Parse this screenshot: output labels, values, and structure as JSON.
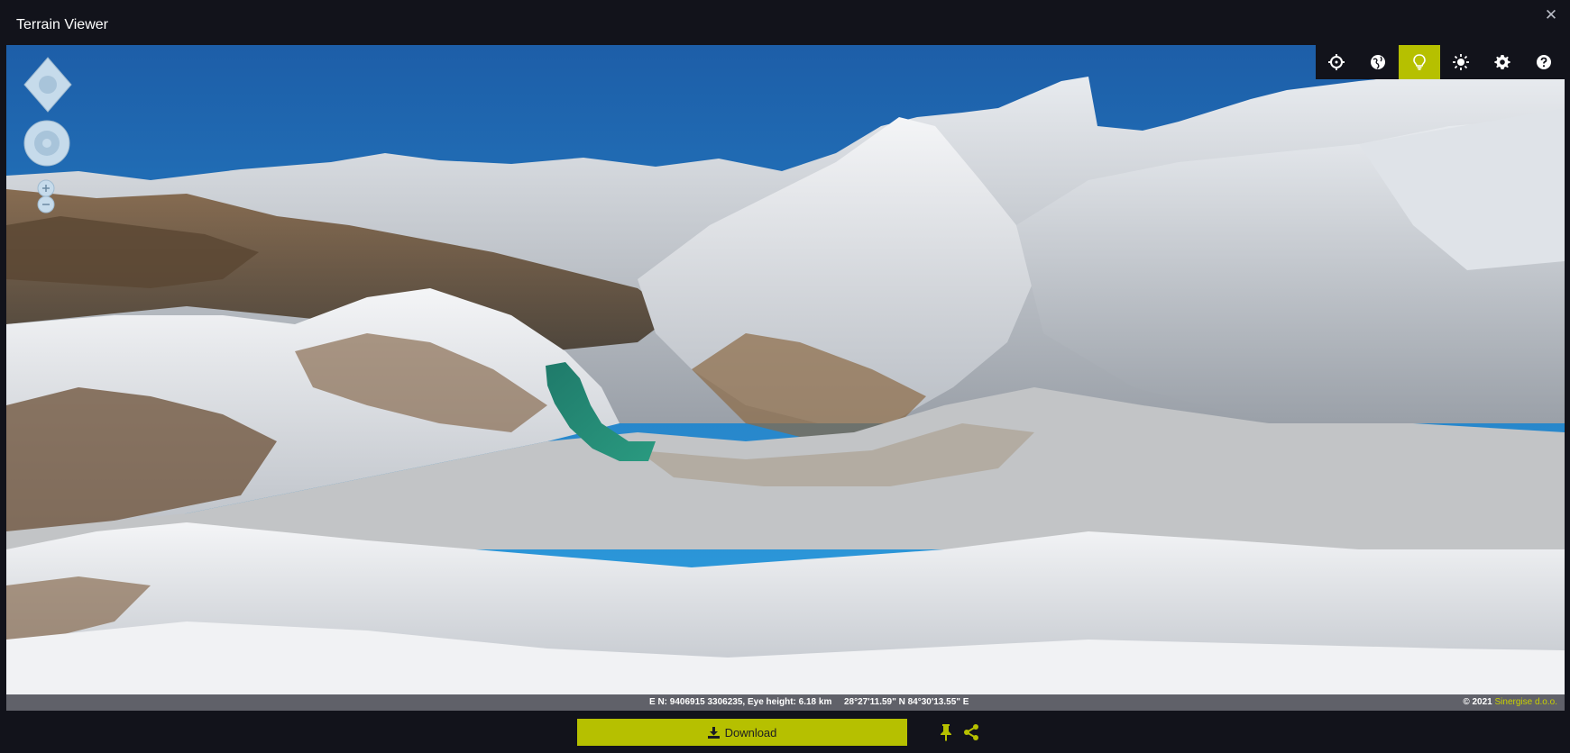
{
  "window": {
    "title": "Terrain Viewer",
    "close_icon": "close-icon"
  },
  "toolbar": {
    "buttons": [
      {
        "name": "crosshair-icon",
        "active": false
      },
      {
        "name": "globe-icon",
        "active": false
      },
      {
        "name": "lightbulb-icon",
        "active": true
      },
      {
        "name": "sun-icon",
        "active": false
      },
      {
        "name": "gear-icon",
        "active": false
      },
      {
        "name": "help-icon",
        "active": false
      }
    ]
  },
  "navigation": {
    "pan_icon": "pan-control-icon",
    "orbit_icon": "orbit-control-icon",
    "zoom_in_icon": "zoom-in-icon",
    "zoom_out_icon": "zoom-out-icon"
  },
  "status": {
    "coords": "E N: 9406915 3306235, Eye height: 6.18 km",
    "latlon": "28°27'11.59\" N 84°30'13.55\" E",
    "copyright": "© 2021",
    "brand": "Sinergise d.o.o."
  },
  "actions": {
    "download_label": "Download",
    "download_icon": "download-icon",
    "pin_icon": "pin-icon",
    "share_icon": "share-icon"
  },
  "colors": {
    "accent": "#b6c000",
    "background": "#12131b",
    "sky": "#2b7fc9"
  }
}
